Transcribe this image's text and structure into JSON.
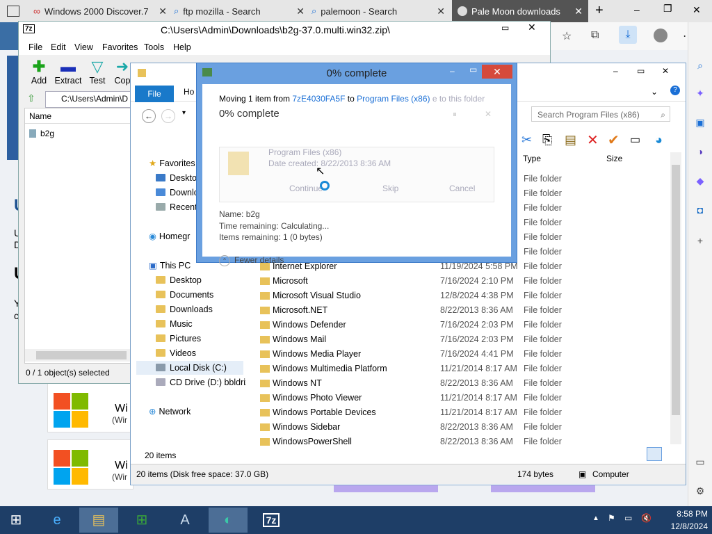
{
  "browser": {
    "tabs": [
      {
        "label": "Windows 2000 Discover.7",
        "icon": "windows-icon"
      },
      {
        "label": "ftp mozilla - Search",
        "icon": "search-icon"
      },
      {
        "label": "palemoon - Search",
        "icon": "search-icon"
      },
      {
        "label": "Pale Moon downloads",
        "icon": "palemoon-icon"
      }
    ],
    "new_tab": "+",
    "window_controls": [
      "–",
      "❐",
      "✕"
    ]
  },
  "sevenzip": {
    "app_icon": "7z",
    "title": "C:\\Users\\Admin\\Downloads\\b2g-37.0.multi.win32.zip\\",
    "menu": [
      "File",
      "Edit",
      "View",
      "Favorites",
      "Tools",
      "Help"
    ],
    "toolbar": [
      {
        "label": "Add",
        "icon": "plus-icon"
      },
      {
        "label": "Extract",
        "icon": "minus-icon"
      },
      {
        "label": "Test",
        "icon": "check-icon"
      },
      {
        "label": "Cop",
        "icon": "copy-arrow-icon"
      }
    ],
    "path": "C:\\Users\\Admin\\D",
    "column_name": "Name",
    "items": [
      "b2g"
    ],
    "status": "0 / 1 object(s) selected"
  },
  "explorer": {
    "ribbon_file": "File",
    "ribbon_home": "Ho",
    "search_placeholder": "Search Program Files (x86)",
    "columns": {
      "type": "Type",
      "size": "Size"
    },
    "tree": {
      "favorites": "Favorites",
      "fav_items": [
        "Deskto",
        "Downlo",
        "Recent"
      ],
      "homegroup": "Homegr",
      "this_pc": "This PC",
      "pc_items": [
        "Desktop",
        "Documents",
        "Downloads",
        "Music",
        "Pictures",
        "Videos",
        "Local Disk (C:)",
        "CD Drive (D:) bbldriz"
      ],
      "network": "Network"
    },
    "rows_top_types": [
      "File folder",
      "File folder",
      "File folder",
      "File folder",
      "File folder",
      "File folder"
    ],
    "rows": [
      {
        "name": "Internet Explorer",
        "date": "11/19/2024 5:58 PM",
        "type": "File folder"
      },
      {
        "name": "Microsoft",
        "date": "7/16/2024 2:10 PM",
        "type": "File folder"
      },
      {
        "name": "Microsoft Visual Studio",
        "date": "12/8/2024 4:38 PM",
        "type": "File folder"
      },
      {
        "name": "Microsoft.NET",
        "date": "8/22/2013 8:36 AM",
        "type": "File folder"
      },
      {
        "name": "Windows Defender",
        "date": "7/16/2024 2:03 PM",
        "type": "File folder"
      },
      {
        "name": "Windows Mail",
        "date": "7/16/2024 2:03 PM",
        "type": "File folder"
      },
      {
        "name": "Windows Media Player",
        "date": "7/16/2024 4:41 PM",
        "type": "File folder"
      },
      {
        "name": "Windows Multimedia Platform",
        "date": "11/21/2014 8:17 AM",
        "type": "File folder"
      },
      {
        "name": "Windows NT",
        "date": "8/22/2013 8:36 AM",
        "type": "File folder"
      },
      {
        "name": "Windows Photo Viewer",
        "date": "11/21/2014 8:17 AM",
        "type": "File folder"
      },
      {
        "name": "Windows Portable Devices",
        "date": "11/21/2014 8:17 AM",
        "type": "File folder"
      },
      {
        "name": "Windows Sidebar",
        "date": "8/22/2013 8:36 AM",
        "type": "File folder"
      },
      {
        "name": "WindowsPowerShell",
        "date": "8/22/2013 8:36 AM",
        "type": "File folder"
      }
    ],
    "item_count": "20 items",
    "status_left": "20 items (Disk free space: 37.0 GB)",
    "status_size": "174 bytes",
    "status_location": "Computer"
  },
  "dialog": {
    "title": "0% complete",
    "moving_text": "Moving 1 item from",
    "from": "7zE4030FA5F",
    "to_word": "to",
    "to": "Program Files (x86)",
    "faded_suffix": "e to this folder",
    "heading": "0% complete",
    "ghost_folder": "Program Files (x86)",
    "ghost_date": "Date created: 8/22/2013 8:36 AM",
    "ghost_buttons": [
      "Continue",
      "Skip",
      "Cancel"
    ],
    "name_label": "Name:",
    "name_value": "b2g",
    "time_label": "Time remaining:",
    "time_value": "Calculating...",
    "items_label": "Items remaining:",
    "items_value": "1 (0 bytes)",
    "fewer_details": "Fewer details",
    "progress_fraction": 0.0
  },
  "bgpage": {
    "letters": [
      "U",
      "U",
      "D",
      "U",
      "Y",
      "c"
    ],
    "win_labels": [
      "Wi",
      "(Wir",
      "Wi",
      "(Wir"
    ]
  },
  "taskbar": {
    "apps": [
      "start",
      "ie",
      "explorer",
      "store",
      "word",
      "edge",
      "7z"
    ],
    "sevenzip_label": "7z",
    "time": "8:58 PM",
    "date": "12/8/2024"
  },
  "colors": {
    "taskbar": "#1e3e67",
    "dialog_frame": "#6aa0e0",
    "ribbon_file": "#1979ca",
    "close_red": "#d64a3c"
  }
}
